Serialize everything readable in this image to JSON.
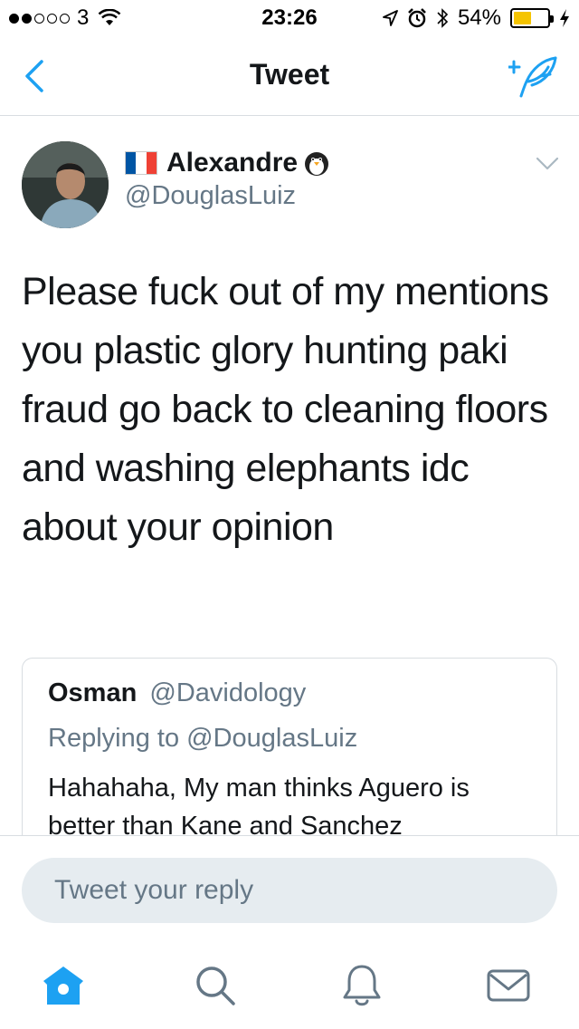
{
  "status_bar": {
    "carrier": "3",
    "time": "23:26",
    "battery_percent": "54%",
    "battery_level": 0.54,
    "signal_bars_filled": 2,
    "signal_bars_total": 5,
    "icons": [
      "signal-icon",
      "wifi-icon",
      "location-icon",
      "alarm-icon",
      "bluetooth-icon",
      "battery-icon",
      "charging-icon"
    ]
  },
  "nav": {
    "title": "Tweet",
    "accent_color": "#1da1f2",
    "icons": [
      "back-chevron-icon",
      "compose-tweet-icon"
    ]
  },
  "tweet": {
    "author_name": "Alexandre",
    "author_handle": "@DouglasLuiz",
    "name_emojis": [
      "france-flag-emoji",
      "penguin-emoji"
    ],
    "text": "Please fuck out of my mentions you plastic glory hunting paki fraud go back to cleaning floors and washing elephants idc about your opinion"
  },
  "quoted_tweet": {
    "author_name": "Osman",
    "author_handle": "@Davidology",
    "replying_prefix": "Replying to",
    "replying_to": "@DouglasLuiz",
    "text": "Hahahaha, My man thinks Aguero is better than Kane and Sanchez"
  },
  "reply": {
    "placeholder": "Tweet your reply"
  },
  "tab_bar": {
    "tabs": [
      "home-icon",
      "search-icon",
      "notifications-icon",
      "messages-icon"
    ],
    "active_tab": "home-icon"
  }
}
